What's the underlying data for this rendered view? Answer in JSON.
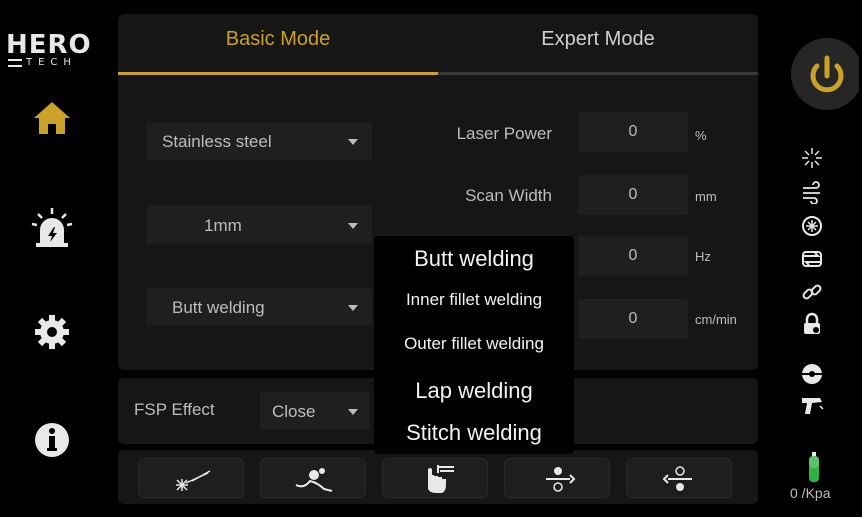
{
  "brand": {
    "logo_big": "HERO",
    "logo_small": "TECH"
  },
  "tabs": [
    {
      "label": "Basic Mode",
      "active": true
    },
    {
      "label": "Expert Mode",
      "active": false
    }
  ],
  "selects": {
    "material": "Stainless steel",
    "thickness": "1mm",
    "weld_type": "Butt welding"
  },
  "params": [
    {
      "label": "Laser Power",
      "value": "0",
      "unit": "%"
    },
    {
      "label": "Scan Width",
      "value": "0",
      "unit": "mm"
    },
    {
      "label": "",
      "value": "0",
      "unit": "Hz"
    },
    {
      "label": "",
      "value": "0",
      "unit": "cm/min"
    }
  ],
  "fsp": {
    "label": "FSP Effect",
    "value": "Close"
  },
  "weld_options": [
    "Butt welding",
    "Inner fillet welding",
    "Outer fillet welding",
    "Lap welding",
    "Stitch welding"
  ],
  "pressure": {
    "text": "0 /Kpa"
  },
  "colors": {
    "accent": "#c9a227",
    "panel": "#161616",
    "field": "#1f1f1f",
    "power_bg": "#262626",
    "gas_green": "#2fb344"
  },
  "icons": {
    "nav": [
      "home-icon",
      "alarm-icon",
      "settings-icon",
      "info-icon"
    ],
    "status": [
      "laser-icon",
      "wind-icon",
      "chiller-icon",
      "sync-icon",
      "link-icon",
      "lock-icon",
      "wire-feed-icon",
      "welding-gun-icon"
    ],
    "tools": [
      "red-light-icon",
      "wire-feeder-icon",
      "touch-icon",
      "gas-in-icon",
      "gas-out-icon"
    ]
  }
}
